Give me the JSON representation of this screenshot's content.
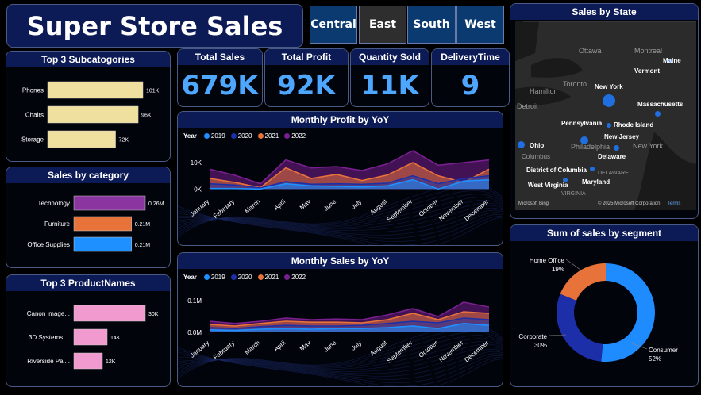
{
  "header": {
    "title": "Super Store Sales"
  },
  "regions": [
    {
      "label": "Central",
      "active": false
    },
    {
      "label": "East",
      "active": true
    },
    {
      "label": "South",
      "active": false
    },
    {
      "label": "West",
      "active": false
    }
  ],
  "kpis": {
    "total_sales": {
      "label": "Total Sales",
      "value": "679K"
    },
    "total_profit": {
      "label": "Total Profit",
      "value": "92K"
    },
    "quantity_sold": {
      "label": "Quantity Sold",
      "value": "11K"
    },
    "delivery_time": {
      "label": "DeliveryTime",
      "value": "9"
    }
  },
  "colors": {
    "y2019": "#1e90ff",
    "y2020": "#1c2fa8",
    "y2021": "#e8733a",
    "y2022": "#7a1f8f"
  },
  "chart_data": [
    {
      "id": "top3-subcategories",
      "type": "bar",
      "orientation": "horizontal",
      "title": "Top 3 Subcatogories",
      "categories": [
        "Phones",
        "Chairs",
        "Storage"
      ],
      "values": [
        101,
        96,
        72
      ],
      "data_labels": [
        "101K",
        "96K",
        "72K"
      ],
      "xlim": [
        0,
        101
      ],
      "color": "#f0e0a0"
    },
    {
      "id": "sales-by-category",
      "type": "bar",
      "orientation": "horizontal",
      "title": "Sales by category",
      "categories": [
        "Technology",
        "Furniture",
        "Office Supplies"
      ],
      "values": [
        0.26,
        0.21,
        0.21
      ],
      "data_labels": [
        "0.26M",
        "0.21M",
        "0.21M"
      ],
      "xlim": [
        0,
        0.26
      ],
      "colors": [
        "#8a35a0",
        "#e8733a",
        "#1e90ff"
      ]
    },
    {
      "id": "top3-productnames",
      "type": "bar",
      "orientation": "horizontal",
      "title": "Top 3 ProductNames",
      "categories": [
        "Canon image...",
        "3D Systems ...",
        "Riverside Pal..."
      ],
      "values": [
        30,
        14,
        12
      ],
      "data_labels": [
        "30K",
        "14K",
        "12K"
      ],
      "xlim": [
        0,
        30
      ],
      "color": "#f09ad0"
    },
    {
      "id": "monthly-profit",
      "type": "area",
      "title": "Monthly Profit by YoY",
      "legend_title": "Year",
      "categories": [
        "January",
        "February",
        "March",
        "April",
        "May",
        "June",
        "July",
        "August",
        "September",
        "October",
        "November",
        "December"
      ],
      "ytick_labels": [
        "0K",
        "10K"
      ],
      "yticks": [
        0,
        10
      ],
      "ylim": [
        -2,
        16
      ],
      "series": [
        {
          "name": "2019",
          "values": [
            0.2,
            0.2,
            0,
            2,
            1.2,
            1,
            0.8,
            1.2,
            3.5,
            0,
            3,
            3.5
          ]
        },
        {
          "name": "2020",
          "values": [
            2,
            1.5,
            0.4,
            2.8,
            1.8,
            2,
            1.8,
            2.2,
            5,
            2,
            4,
            5
          ]
        },
        {
          "name": "2021",
          "values": [
            4,
            2.5,
            0.5,
            8,
            4,
            5.5,
            3.2,
            5.3,
            10,
            5,
            2.5,
            7.5
          ]
        },
        {
          "name": "2022",
          "values": [
            7.5,
            5.2,
            2,
            11,
            8,
            8.5,
            7,
            9.5,
            14.5,
            9,
            10,
            11
          ]
        }
      ]
    },
    {
      "id": "monthly-sales",
      "type": "area",
      "title": "Monthly Sales by YoY",
      "legend_title": "Year",
      "categories": [
        "January",
        "February",
        "March",
        "April",
        "May",
        "June",
        "July",
        "August",
        "September",
        "October",
        "November",
        "December"
      ],
      "ytick_labels": [
        "0.0M",
        "0.1M"
      ],
      "yticks": [
        0,
        0.1
      ],
      "ylim": [
        -0.01,
        0.14
      ],
      "series": [
        {
          "name": "2019",
          "values": [
            0.008,
            0.006,
            0.01,
            0.012,
            0.01,
            0.012,
            0.012,
            0.015,
            0.02,
            0.012,
            0.028,
            0.022
          ]
        },
        {
          "name": "2020",
          "values": [
            0.015,
            0.012,
            0.018,
            0.022,
            0.02,
            0.02,
            0.022,
            0.028,
            0.035,
            0.03,
            0.045,
            0.04
          ]
        },
        {
          "name": "2021",
          "values": [
            0.025,
            0.02,
            0.028,
            0.035,
            0.032,
            0.032,
            0.03,
            0.04,
            0.06,
            0.04,
            0.065,
            0.06
          ]
        },
        {
          "name": "2022",
          "values": [
            0.035,
            0.028,
            0.035,
            0.045,
            0.04,
            0.042,
            0.04,
            0.055,
            0.075,
            0.05,
            0.095,
            0.08
          ]
        }
      ]
    },
    {
      "id": "sales-by-segment",
      "type": "pie",
      "donut": true,
      "title": "Sum of sales by segment",
      "slices": [
        {
          "label": "Consumer",
          "pct": 52,
          "pct_label": "52%",
          "color": "#1e8bff"
        },
        {
          "label": "Corporate",
          "pct": 30,
          "pct_label": "30%",
          "color": "#1c2fa8"
        },
        {
          "label": "Home Office",
          "pct": 19,
          "pct_label": "19%",
          "color": "#e8733a"
        }
      ]
    }
  ],
  "map": {
    "title": "Sales by State",
    "labels": [
      "Ottawa",
      "Montreal",
      "Maine",
      "Vermont",
      "Toronto",
      "New York",
      "Hamilton",
      "Detroit",
      "Massachusetts",
      "Pennsylvania",
      "Rhode Island",
      "Ohio",
      "New Jersey",
      "Philadelphia",
      "New York",
      "Delaware",
      "Columbus",
      "District of Columbia",
      "DELAWARE",
      "Maryland",
      "West Virginia",
      "VIRGINIA"
    ],
    "footer_left": "Microsoft Bing",
    "footer_right": "© 2025 Microsoft Corporation",
    "footer_terms": "Terms"
  }
}
